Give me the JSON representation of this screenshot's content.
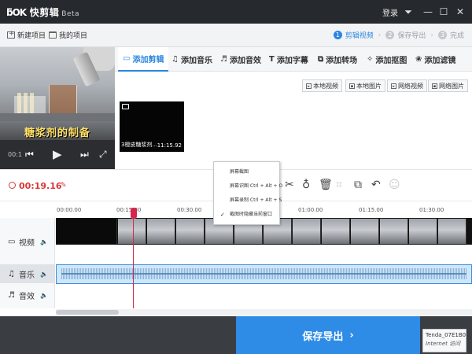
{
  "app": {
    "name": "快剪辑",
    "badge": "Beta",
    "login": "登录"
  },
  "toolbar": {
    "new_project": "新建项目",
    "my_projects": "我的项目"
  },
  "steps": [
    {
      "num": "1",
      "label": "剪辑视频"
    },
    {
      "num": "2",
      "label": "保存导出"
    },
    {
      "num": "3",
      "label": "完成"
    }
  ],
  "preview": {
    "subtitle": "糖浆剂的制备",
    "time": "00:1"
  },
  "tabs": [
    "添加剪辑",
    "添加音乐",
    "添加音效",
    "添加字幕",
    "添加转场",
    "添加抠图",
    "添加滤镜"
  ],
  "media_buttons": [
    "本地视频",
    "本地图片",
    "网络视频",
    "网络图片"
  ],
  "clip": {
    "name": "3橙皮糖浆剂...",
    "duration": "11:15.92"
  },
  "edit": {
    "current_time": "00:19.16"
  },
  "context_menu": [
    {
      "label": "屏幕截图",
      "checked": false
    },
    {
      "label": "屏幕识图 Ctrl + Alt + O",
      "checked": false
    },
    {
      "label": "屏幕录制 Ctrl + Alt + S",
      "checked": false
    },
    {
      "label": "截图时隐藏当前窗口",
      "checked": true
    }
  ],
  "ruler": [
    "00:00.00",
    "00:15.00",
    "00:30.00",
    "01:00.00",
    "01:15.00",
    "01:30.00"
  ],
  "tracks": {
    "video": "视频",
    "music": "音乐",
    "sound": "音效"
  },
  "footer": {
    "export_label": "保存导出",
    "notify_title": "Tenda_07E1B0",
    "notify_sub": "Internet 访问"
  },
  "colors": {
    "accent": "#2e8ce6",
    "timecode": "#d9383a",
    "playhead": "#d6254f",
    "titlebar": "#26292e"
  }
}
